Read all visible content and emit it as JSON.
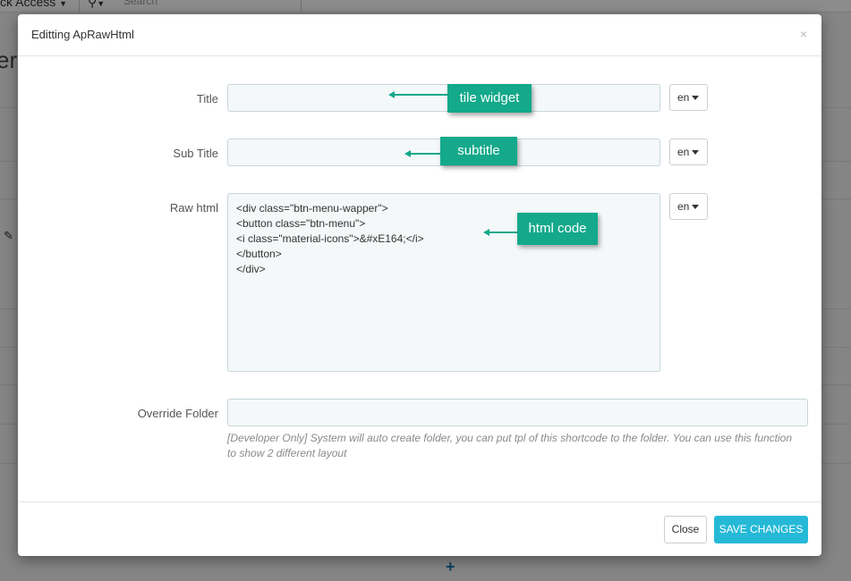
{
  "background": {
    "quick_access": "ck Access",
    "search_placeholder": "Search",
    "heading_fragment": "er"
  },
  "modal": {
    "title": "Editting ApRawHtml",
    "close_symbol": "×",
    "fields": {
      "title": {
        "label": "Title",
        "value": "",
        "lang": "en"
      },
      "subtitle": {
        "label": "Sub Title",
        "value": "",
        "lang": "en"
      },
      "raw_html": {
        "label": "Raw html",
        "lang": "en",
        "lines": [
          "<div class=\"btn-menu-wapper\">",
          "<button class=\"btn-menu\">",
          "<i class=\"material-icons\">&#xE164;</i>",
          "</button>",
          "</div>"
        ]
      },
      "override_folder": {
        "label": "Override Folder",
        "value": "",
        "help": "[Developer Only] System will auto create folder, you can put tpl of this shortcode to the folder. You can use this function to show 2 different layout"
      }
    },
    "footer": {
      "close_label": "Close",
      "save_label": "SAVE CHANGES"
    }
  },
  "annotations": {
    "title_callout": "tile widget",
    "subtitle_callout": "subtitle",
    "raw_callout": "html code",
    "color": "#13a98a"
  }
}
